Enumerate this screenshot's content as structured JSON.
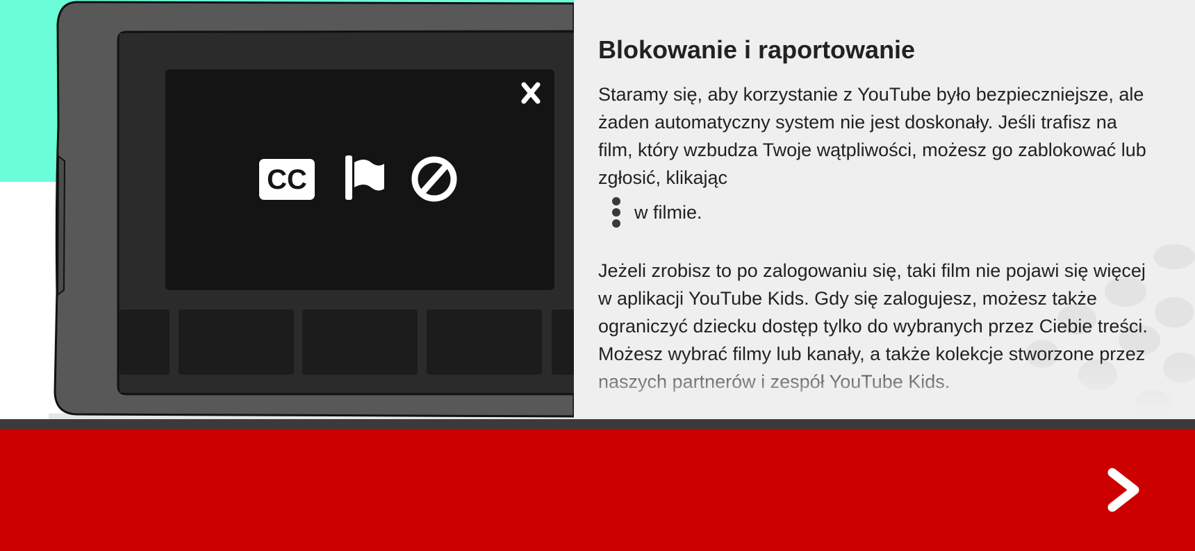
{
  "panel": {
    "title": "Blokowanie i raportowanie",
    "paragraph1": "Staramy się, aby korzystanie z YouTube było bezpieczniejsze, ale żaden automatyczny system nie jest doskonały. Jeśli trafisz na film, który wzbudza Twoje wątpliwości, możesz go zablokować lub zgłosić, klikając",
    "paragraph1_tail": "w filmie.",
    "paragraph2": "Jeżeli zrobisz to po zalogowaniu się, taki film nie pojawi się więcej w aplikacji YouTube Kids. Gdy się zalogujesz, możesz także ograniczyć dziecku dostęp tylko do wybranych przez Ciebie treści. Możesz wybrać filmy lub kanały, a także kolekcje stworzone przez naszych partnerów i zespół YouTube Kids."
  },
  "illustration": {
    "icons": [
      "close-icon",
      "closed-captions-icon",
      "flag-icon",
      "block-icon"
    ],
    "cc_label": "CC"
  },
  "footer": {
    "next_icon": "chevron-right-icon"
  },
  "colors": {
    "mint": "#6bfdd8",
    "panel_bg": "#efefef",
    "footer_red": "#cc0000",
    "divider": "#3b3b3b",
    "device_body": "#585858",
    "screen_dark": "#141414"
  }
}
